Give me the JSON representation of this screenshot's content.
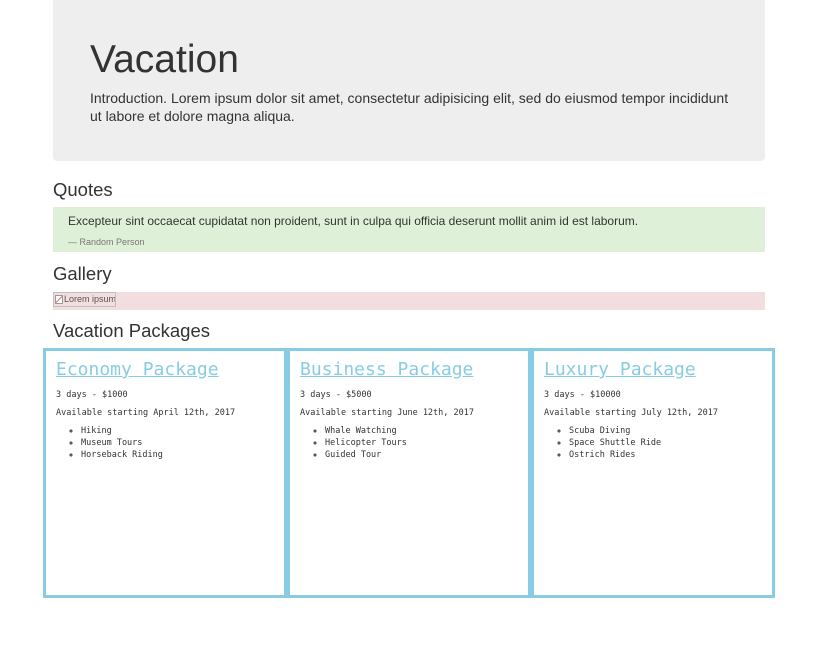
{
  "jumbotron": {
    "title": "Vacation",
    "intro": "Introduction. Lorem ipsum dolor sit amet, consectetur adipisicing elit, sed do eiusmod tempor incididunt ut labore et dolore magna aliqua."
  },
  "quotes": {
    "heading": "Quotes",
    "text": "Excepteur sint occaecat cupidatat non proident, sunt in culpa qui officia deserunt mollit anim id est laborum.",
    "author": "— Random Person",
    "background": "#dff0d8"
  },
  "gallery": {
    "heading": "Gallery",
    "image_alt": "Lorem ipsum",
    "background": "#f2dede"
  },
  "packages": {
    "heading": "Vacation Packages",
    "accent": "#88cce4",
    "items": [
      {
        "title": "Economy Package",
        "summary": "3 days - $1000",
        "availability": "Available starting April 12th, 2017",
        "activities": [
          "Hiking",
          "Museum Tours",
          "Horseback Riding"
        ]
      },
      {
        "title": "Business Package",
        "summary": "3 days - $5000",
        "availability": "Available starting June 12th, 2017",
        "activities": [
          "Whale Watching",
          "Helicopter Tours",
          "Guided Tour"
        ]
      },
      {
        "title": "Luxury Package",
        "summary": "3 days - $10000",
        "availability": "Available starting July 12th, 2017",
        "activities": [
          "Scuba Diving",
          "Space Shuttle Ride",
          "Ostrich Rides"
        ]
      }
    ]
  }
}
